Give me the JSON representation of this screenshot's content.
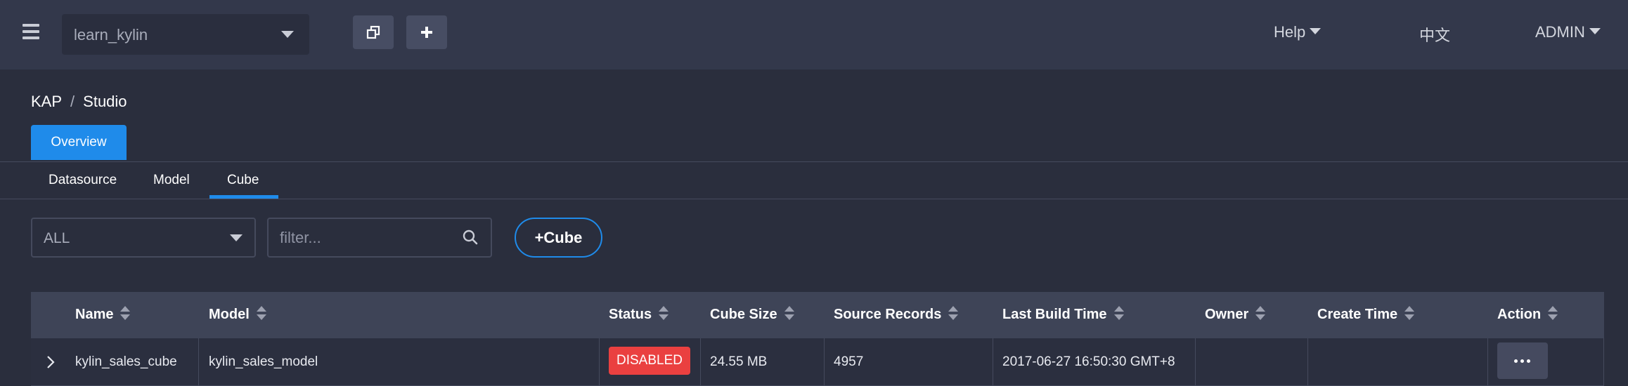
{
  "topbar": {
    "project": "learn_kylin",
    "help_label": "Help",
    "language_label": "中文",
    "user_label": "ADMIN"
  },
  "breadcrumb": {
    "root": "KAP",
    "separator": "/",
    "current": "Studio"
  },
  "main_tab": "Overview",
  "subtabs": [
    "Datasource",
    "Model",
    "Cube"
  ],
  "active_subtab": "Cube",
  "filter": {
    "status_value": "ALL",
    "search_placeholder": "filter...",
    "add_button": "+Cube"
  },
  "table": {
    "headers": [
      "Name",
      "Model",
      "Status",
      "Cube Size",
      "Source Records",
      "Last Build Time",
      "Owner",
      "Create Time",
      "Action"
    ],
    "rows": [
      {
        "name": "kylin_sales_cube",
        "model": "kylin_sales_model",
        "status": "DISABLED",
        "cube_size": "24.55 MB",
        "source_records": "4957",
        "last_build_time": "2017-06-27 16:50:30 GMT+8",
        "owner": "",
        "create_time": ""
      }
    ]
  },
  "colors": {
    "accent": "#1f8bea",
    "status_disabled": "#ea4040",
    "topbar_bg": "#33384b",
    "page_bg": "#2a2e3d"
  },
  "icons": {
    "menu": "hamburger-icon",
    "project_caret": "chevron-down-icon",
    "copy": "copy-icon",
    "add": "plus-icon",
    "search": "search-icon",
    "sort": "sort-icon",
    "expand": "chevron-right-icon",
    "action": "more-icon"
  }
}
